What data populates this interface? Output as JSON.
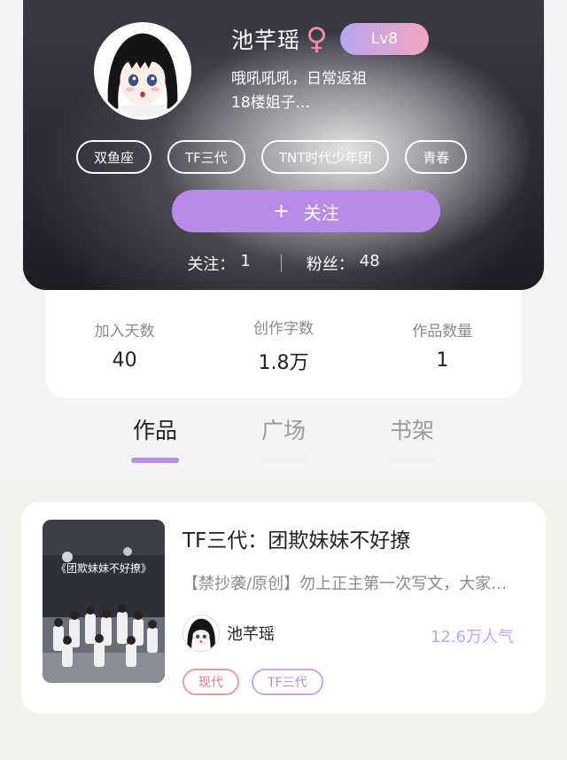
{
  "profile": {
    "name": "池芊瑶",
    "gender_icon": "female-icon",
    "gender_symbol": "♀",
    "level": "Lv8",
    "bio_line1": "哦吼吼吼，日常返祖",
    "bio_line2": "18楼姐子...",
    "tags": [
      "双鱼座",
      "TF三代",
      "TNT时代少年团",
      "青春"
    ],
    "follow_plus": "+",
    "follow_label": "关注",
    "following_label": "关注：",
    "following_count": "1",
    "fans_label": "粉丝：",
    "fans_count": "48"
  },
  "info": {
    "days_label": "加入天数",
    "days_value": "40",
    "words_label": "创作字数",
    "words_value": "1.8万",
    "works_label": "作品数量",
    "works_value": "1"
  },
  "tabs": [
    {
      "label": "作品",
      "active": true
    },
    {
      "label": "广场",
      "active": false
    },
    {
      "label": "书架",
      "active": false
    }
  ],
  "work": {
    "title": "TF三代：团欺妹妹不好撩",
    "description": "【禁抄袭/原创】勿上正主第一次写文，大家多多支持",
    "cover_text": "《团欺妹妹不好撩》",
    "author": "池芊瑶",
    "popularity": "12.6万人气",
    "tags": [
      "现代",
      "TF三代"
    ]
  },
  "colors": {
    "accent": "#b98be8",
    "gender": "#f08aa3",
    "popularity": "#c7a3ea"
  }
}
